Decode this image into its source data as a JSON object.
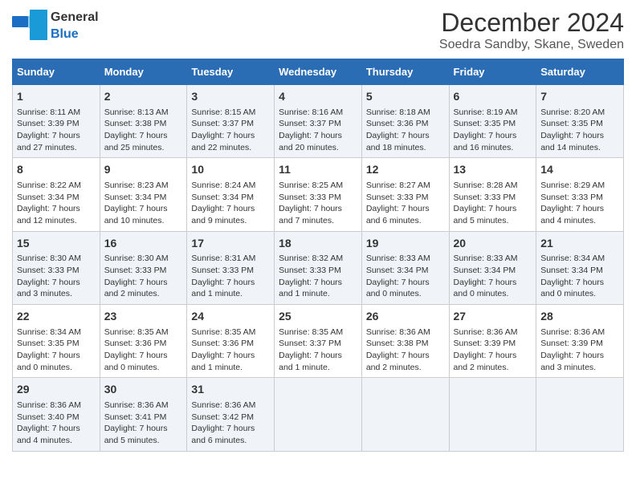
{
  "header": {
    "logo_general": "General",
    "logo_blue": "Blue",
    "main_title": "December 2024",
    "subtitle": "Soedra Sandby, Skane, Sweden"
  },
  "days_of_week": [
    "Sunday",
    "Monday",
    "Tuesday",
    "Wednesday",
    "Thursday",
    "Friday",
    "Saturday"
  ],
  "weeks": [
    [
      {
        "day": "1",
        "sunrise": "Sunrise: 8:11 AM",
        "sunset": "Sunset: 3:39 PM",
        "daylight": "Daylight: 7 hours and 27 minutes."
      },
      {
        "day": "2",
        "sunrise": "Sunrise: 8:13 AM",
        "sunset": "Sunset: 3:38 PM",
        "daylight": "Daylight: 7 hours and 25 minutes."
      },
      {
        "day": "3",
        "sunrise": "Sunrise: 8:15 AM",
        "sunset": "Sunset: 3:37 PM",
        "daylight": "Daylight: 7 hours and 22 minutes."
      },
      {
        "day": "4",
        "sunrise": "Sunrise: 8:16 AM",
        "sunset": "Sunset: 3:37 PM",
        "daylight": "Daylight: 7 hours and 20 minutes."
      },
      {
        "day": "5",
        "sunrise": "Sunrise: 8:18 AM",
        "sunset": "Sunset: 3:36 PM",
        "daylight": "Daylight: 7 hours and 18 minutes."
      },
      {
        "day": "6",
        "sunrise": "Sunrise: 8:19 AM",
        "sunset": "Sunset: 3:35 PM",
        "daylight": "Daylight: 7 hours and 16 minutes."
      },
      {
        "day": "7",
        "sunrise": "Sunrise: 8:20 AM",
        "sunset": "Sunset: 3:35 PM",
        "daylight": "Daylight: 7 hours and 14 minutes."
      }
    ],
    [
      {
        "day": "8",
        "sunrise": "Sunrise: 8:22 AM",
        "sunset": "Sunset: 3:34 PM",
        "daylight": "Daylight: 7 hours and 12 minutes."
      },
      {
        "day": "9",
        "sunrise": "Sunrise: 8:23 AM",
        "sunset": "Sunset: 3:34 PM",
        "daylight": "Daylight: 7 hours and 10 minutes."
      },
      {
        "day": "10",
        "sunrise": "Sunrise: 8:24 AM",
        "sunset": "Sunset: 3:34 PM",
        "daylight": "Daylight: 7 hours and 9 minutes."
      },
      {
        "day": "11",
        "sunrise": "Sunrise: 8:25 AM",
        "sunset": "Sunset: 3:33 PM",
        "daylight": "Daylight: 7 hours and 7 minutes."
      },
      {
        "day": "12",
        "sunrise": "Sunrise: 8:27 AM",
        "sunset": "Sunset: 3:33 PM",
        "daylight": "Daylight: 7 hours and 6 minutes."
      },
      {
        "day": "13",
        "sunrise": "Sunrise: 8:28 AM",
        "sunset": "Sunset: 3:33 PM",
        "daylight": "Daylight: 7 hours and 5 minutes."
      },
      {
        "day": "14",
        "sunrise": "Sunrise: 8:29 AM",
        "sunset": "Sunset: 3:33 PM",
        "daylight": "Daylight: 7 hours and 4 minutes."
      }
    ],
    [
      {
        "day": "15",
        "sunrise": "Sunrise: 8:30 AM",
        "sunset": "Sunset: 3:33 PM",
        "daylight": "Daylight: 7 hours and 3 minutes."
      },
      {
        "day": "16",
        "sunrise": "Sunrise: 8:30 AM",
        "sunset": "Sunset: 3:33 PM",
        "daylight": "Daylight: 7 hours and 2 minutes."
      },
      {
        "day": "17",
        "sunrise": "Sunrise: 8:31 AM",
        "sunset": "Sunset: 3:33 PM",
        "daylight": "Daylight: 7 hours and 1 minute."
      },
      {
        "day": "18",
        "sunrise": "Sunrise: 8:32 AM",
        "sunset": "Sunset: 3:33 PM",
        "daylight": "Daylight: 7 hours and 1 minute."
      },
      {
        "day": "19",
        "sunrise": "Sunrise: 8:33 AM",
        "sunset": "Sunset: 3:34 PM",
        "daylight": "Daylight: 7 hours and 0 minutes."
      },
      {
        "day": "20",
        "sunrise": "Sunrise: 8:33 AM",
        "sunset": "Sunset: 3:34 PM",
        "daylight": "Daylight: 7 hours and 0 minutes."
      },
      {
        "day": "21",
        "sunrise": "Sunrise: 8:34 AM",
        "sunset": "Sunset: 3:34 PM",
        "daylight": "Daylight: 7 hours and 0 minutes."
      }
    ],
    [
      {
        "day": "22",
        "sunrise": "Sunrise: 8:34 AM",
        "sunset": "Sunset: 3:35 PM",
        "daylight": "Daylight: 7 hours and 0 minutes."
      },
      {
        "day": "23",
        "sunrise": "Sunrise: 8:35 AM",
        "sunset": "Sunset: 3:36 PM",
        "daylight": "Daylight: 7 hours and 0 minutes."
      },
      {
        "day": "24",
        "sunrise": "Sunrise: 8:35 AM",
        "sunset": "Sunset: 3:36 PM",
        "daylight": "Daylight: 7 hours and 1 minute."
      },
      {
        "day": "25",
        "sunrise": "Sunrise: 8:35 AM",
        "sunset": "Sunset: 3:37 PM",
        "daylight": "Daylight: 7 hours and 1 minute."
      },
      {
        "day": "26",
        "sunrise": "Sunrise: 8:36 AM",
        "sunset": "Sunset: 3:38 PM",
        "daylight": "Daylight: 7 hours and 2 minutes."
      },
      {
        "day": "27",
        "sunrise": "Sunrise: 8:36 AM",
        "sunset": "Sunset: 3:39 PM",
        "daylight": "Daylight: 7 hours and 2 minutes."
      },
      {
        "day": "28",
        "sunrise": "Sunrise: 8:36 AM",
        "sunset": "Sunset: 3:39 PM",
        "daylight": "Daylight: 7 hours and 3 minutes."
      }
    ],
    [
      {
        "day": "29",
        "sunrise": "Sunrise: 8:36 AM",
        "sunset": "Sunset: 3:40 PM",
        "daylight": "Daylight: 7 hours and 4 minutes."
      },
      {
        "day": "30",
        "sunrise": "Sunrise: 8:36 AM",
        "sunset": "Sunset: 3:41 PM",
        "daylight": "Daylight: 7 hours and 5 minutes."
      },
      {
        "day": "31",
        "sunrise": "Sunrise: 8:36 AM",
        "sunset": "Sunset: 3:42 PM",
        "daylight": "Daylight: 7 hours and 6 minutes."
      },
      null,
      null,
      null,
      null
    ]
  ]
}
